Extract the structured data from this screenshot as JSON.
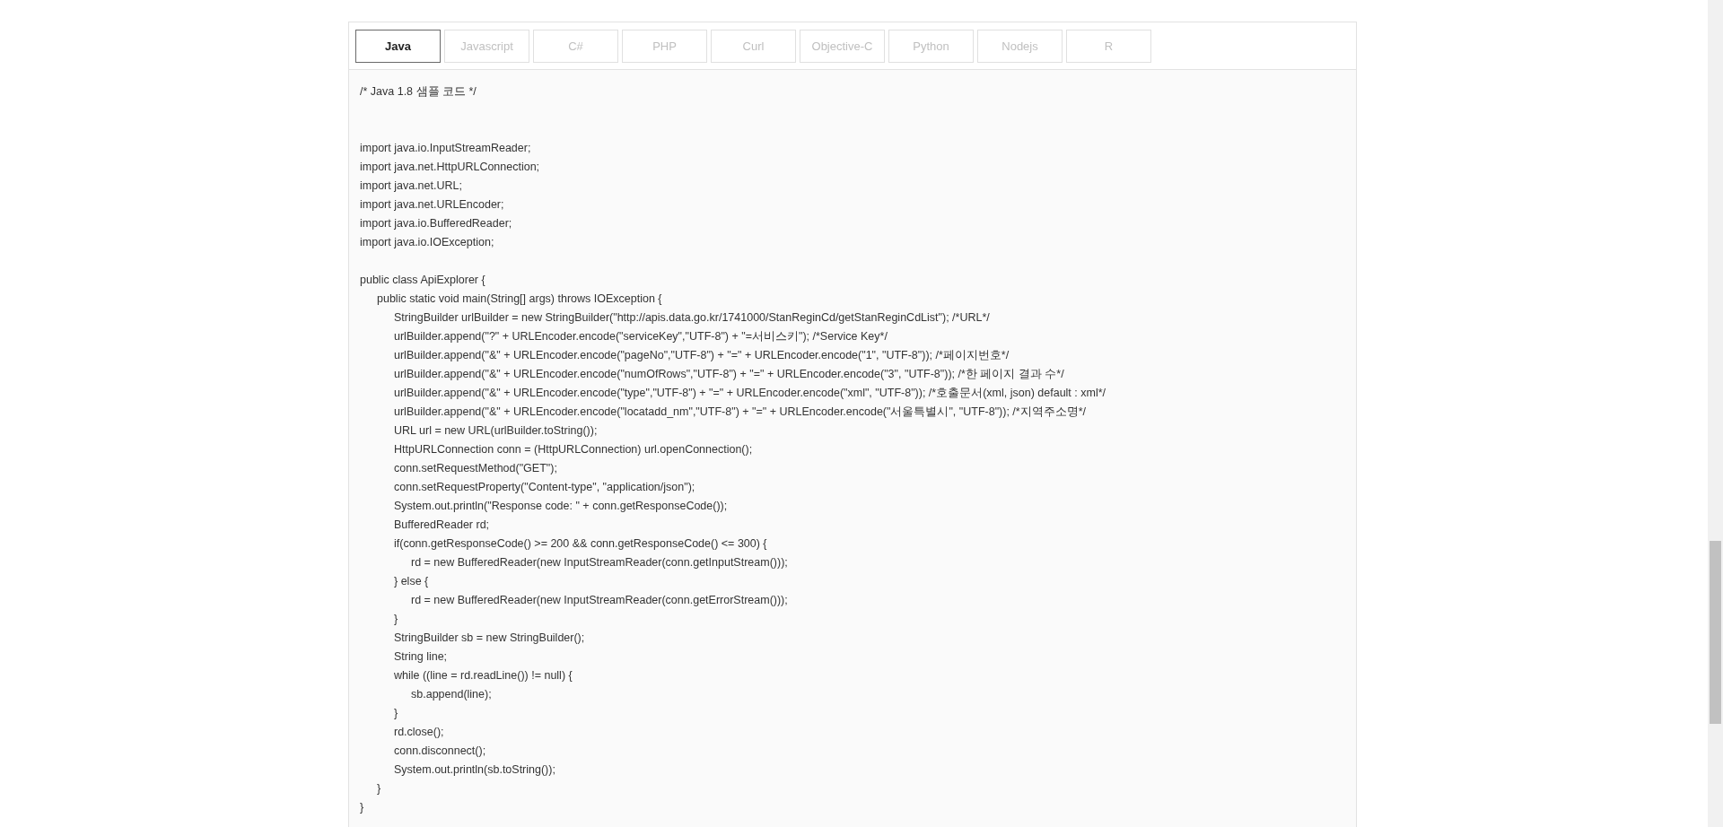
{
  "tabs": [
    {
      "label": "Java",
      "selected": true
    },
    {
      "label": "Javascript",
      "selected": false
    },
    {
      "label": "C#",
      "selected": false
    },
    {
      "label": "PHP",
      "selected": false
    },
    {
      "label": "Curl",
      "selected": false
    },
    {
      "label": "Objective-C",
      "selected": false
    },
    {
      "label": "Python",
      "selected": false
    },
    {
      "label": "Nodejs",
      "selected": false
    },
    {
      "label": "R",
      "selected": false
    }
  ],
  "code": "/* Java 1.8 샘플 코드 */\n\n\nimport java.io.InputStreamReader;\nimport java.net.HttpURLConnection;\nimport java.net.URL;\nimport java.net.URLEncoder;\nimport java.io.BufferedReader;\nimport java.io.IOException;\n\npublic class ApiExplorer {\n\tpublic static void main(String[] args) throws IOException {\n\t\tStringBuilder urlBuilder = new StringBuilder(\"http://apis.data.go.kr/1741000/StanReginCd/getStanReginCdList\"); /*URL*/\n\t\turlBuilder.append(\"?\" + URLEncoder.encode(\"serviceKey\",\"UTF-8\") + \"=서비스키\"); /*Service Key*/\n\t\turlBuilder.append(\"&\" + URLEncoder.encode(\"pageNo\",\"UTF-8\") + \"=\" + URLEncoder.encode(\"1\", \"UTF-8\")); /*페이지번호*/\n\t\turlBuilder.append(\"&\" + URLEncoder.encode(\"numOfRows\",\"UTF-8\") + \"=\" + URLEncoder.encode(\"3\", \"UTF-8\")); /*한 페이지 결과 수*/\n\t\turlBuilder.append(\"&\" + URLEncoder.encode(\"type\",\"UTF-8\") + \"=\" + URLEncoder.encode(\"xml\", \"UTF-8\")); /*호출문서(xml, json) default : xml*/\n\t\turlBuilder.append(\"&\" + URLEncoder.encode(\"locatadd_nm\",\"UTF-8\") + \"=\" + URLEncoder.encode(\"서울특별시\", \"UTF-8\")); /*지역주소명*/\n\t\tURL url = new URL(urlBuilder.toString());\n\t\tHttpURLConnection conn = (HttpURLConnection) url.openConnection();\n\t\tconn.setRequestMethod(\"GET\");\n\t\tconn.setRequestProperty(\"Content-type\", \"application/json\");\n\t\tSystem.out.println(\"Response code: \" + conn.getResponseCode());\n\t\tBufferedReader rd;\n\t\tif(conn.getResponseCode() >= 200 && conn.getResponseCode() <= 300) {\n\t\t\trd = new BufferedReader(new InputStreamReader(conn.getInputStream()));\n\t\t} else {\n\t\t\trd = new BufferedReader(new InputStreamReader(conn.getErrorStream()));\n\t\t}\n\t\tStringBuilder sb = new StringBuilder();\n\t\tString line;\n\t\twhile ((line = rd.readLine()) != null) {\n\t\t\tsb.append(line);\n\t\t}\n\t\trd.close();\n\t\tconn.disconnect();\n\t\tSystem.out.println(sb.toString());\n\t}\n}"
}
